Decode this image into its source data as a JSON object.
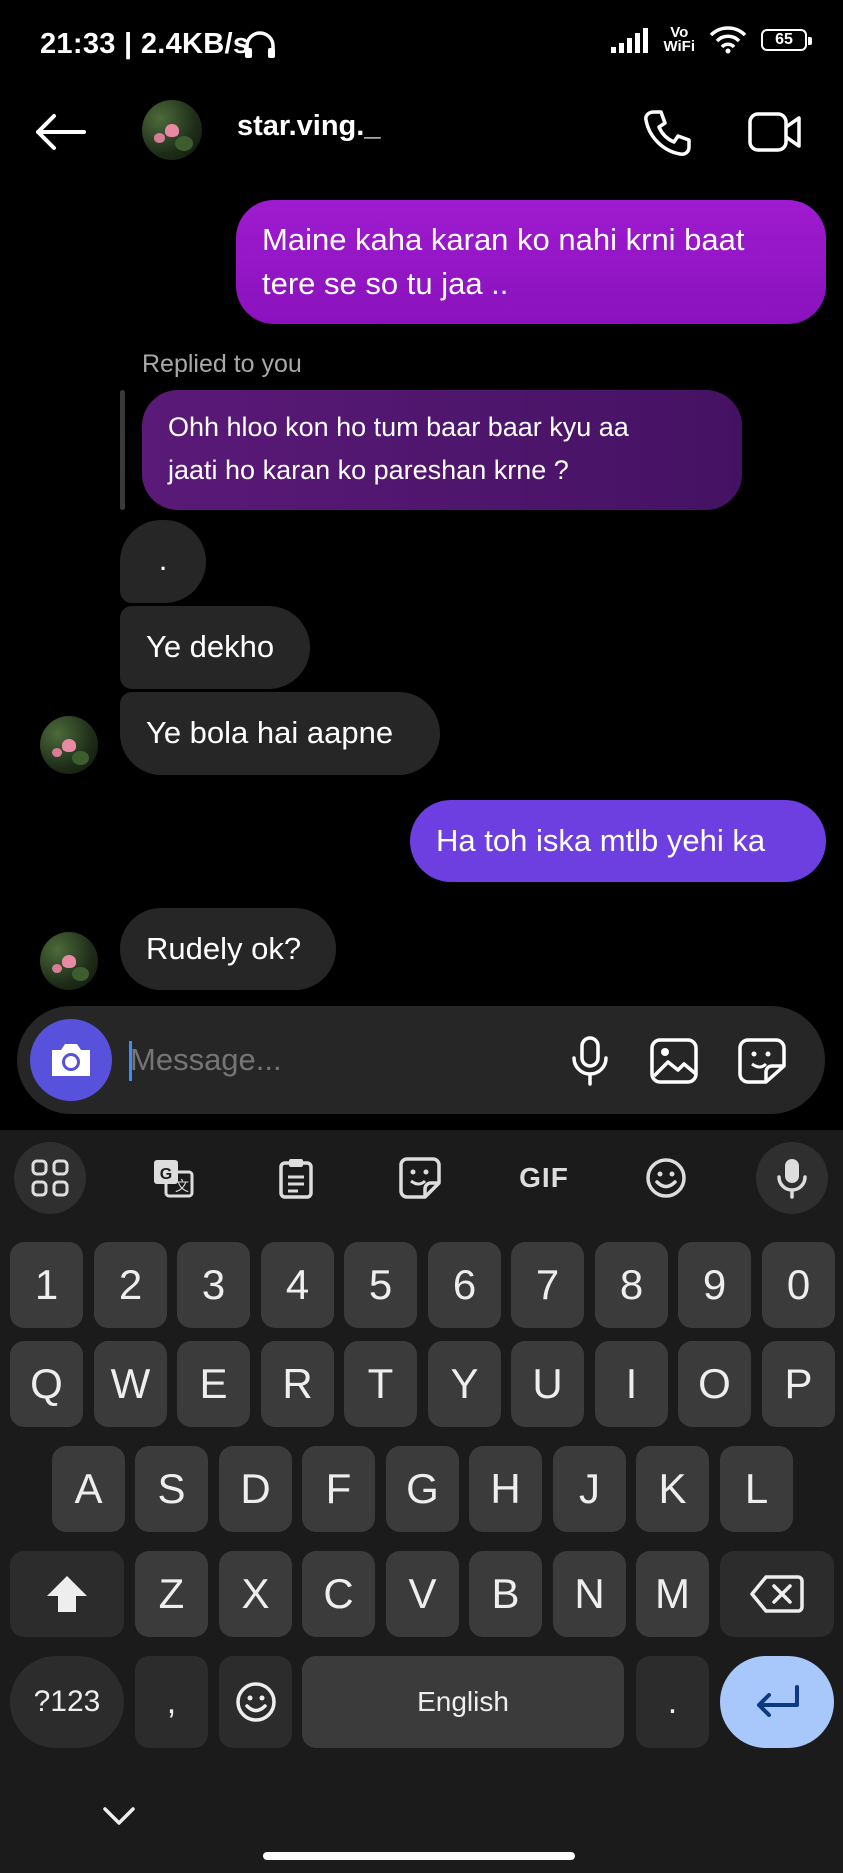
{
  "status_bar": {
    "time": "21:33",
    "separator": "|",
    "net_speed": "2.4KB/s",
    "volte_top": "Vo",
    "volte_bottom": "WiFi",
    "battery": "65"
  },
  "header": {
    "username": "star.ving._"
  },
  "messages": {
    "m1_line1": "Maine kaha karan ko nahi krni baat",
    "m1_line2": "tere se so tu jaa ..",
    "replied_label": "Replied to you",
    "quote_line1": "Ohh hloo kon ho tum baar baar kyu aa",
    "quote_line2": "jaati ho karan ko pareshan krne ?",
    "m2": ".",
    "m3": "Ye dekho",
    "m4": "Ye bola hai aapne",
    "m5": "Ha toh iska mtlb yehi ka",
    "m6": "Rudely ok?"
  },
  "composer": {
    "placeholder": "Message..."
  },
  "keyboard": {
    "row_numbers": [
      "1",
      "2",
      "3",
      "4",
      "5",
      "6",
      "7",
      "8",
      "9",
      "0"
    ],
    "row_q": [
      "Q",
      "W",
      "E",
      "R",
      "T",
      "Y",
      "U",
      "I",
      "O",
      "P"
    ],
    "row_a": [
      "A",
      "S",
      "D",
      "F",
      "G",
      "H",
      "J",
      "K",
      "L"
    ],
    "row_z": [
      "Z",
      "X",
      "C",
      "V",
      "B",
      "N",
      "M"
    ],
    "sym_key": "?123",
    "comma_key": ",",
    "space_key": "English",
    "period_key": ".",
    "gif_label": "GIF"
  },
  "colors": {
    "outgoing_purple": "#9f1bcf",
    "outgoing_violet": "#6d3fe1",
    "incoming_gray": "#262626",
    "camera_button": "#5851db",
    "enter_key": "#a8c7fa"
  }
}
